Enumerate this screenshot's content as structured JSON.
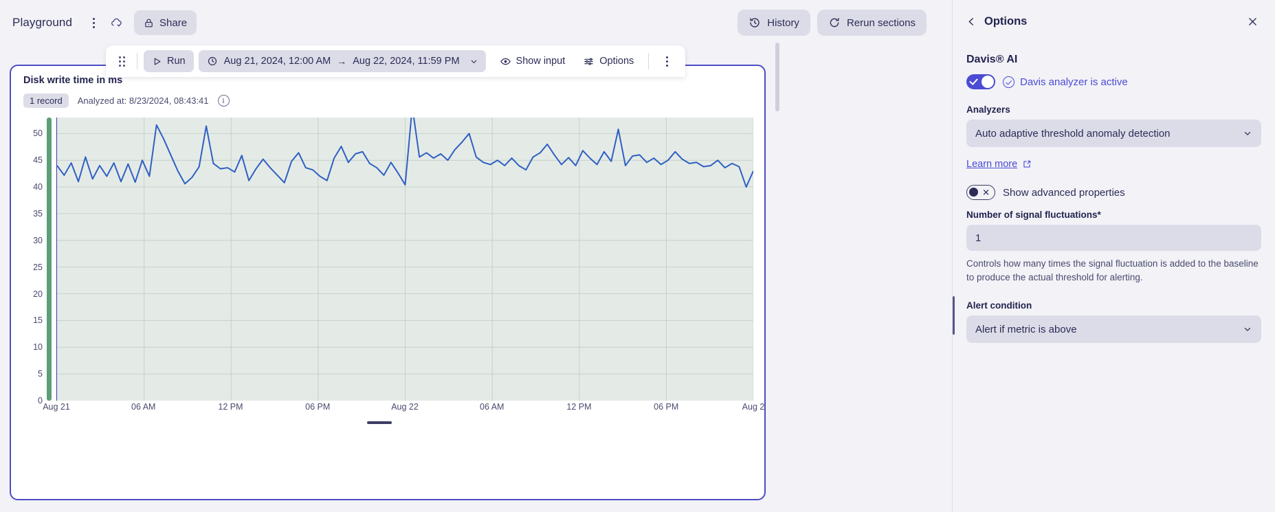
{
  "topbar": {
    "notebook_title": "Playground",
    "more_icon": "kebab-menu-icon",
    "sync_icon": "cloud-sync-icon",
    "share_label": "Share",
    "share_icon": "lock-icon",
    "history_label": "History",
    "history_icon": "history-clock-icon",
    "rerun_label": "Rerun sections",
    "rerun_icon": "refresh-icon"
  },
  "section_toolbar": {
    "drag_handle": "drag-handle-icon",
    "run_label": "Run",
    "run_icon": "play-icon",
    "timeframe_icon": "clock-icon",
    "timeframe_from": "Aug 21, 2024, 12:00 AM",
    "timeframe_arrow": "→",
    "timeframe_to": "Aug 22, 2024, 11:59 PM",
    "timeframe_chevron": "chevron-down-icon",
    "show_input_label": "Show input",
    "show_input_icon": "eye-icon",
    "options_label": "Options",
    "options_icon": "sliders-icon",
    "more_icon": "kebab-menu-icon"
  },
  "section": {
    "title": "Disk write time in ms",
    "record_badge": "1 record",
    "analyzed_at": "Analyzed at: 8/23/2024, 08:43:41",
    "info_icon": "info-icon"
  },
  "chart_data": {
    "type": "line",
    "title": "Disk write time in ms",
    "xlabel": "",
    "ylabel": "",
    "ylim": [
      0,
      53
    ],
    "yticks": [
      0,
      5,
      10,
      15,
      20,
      25,
      30,
      35,
      40,
      45,
      50
    ],
    "xticks": [
      "Aug 21",
      "06 AM",
      "12 PM",
      "06 PM",
      "Aug 22",
      "06 AM",
      "12 PM",
      "06 PM",
      "Aug 2"
    ],
    "grid": true,
    "legend": "none",
    "line_color": "#2f5fc4",
    "plot_background": "#e4ebe6",
    "threshold_band_color": "#5b9e78",
    "series": [
      {
        "name": "Disk write time in ms",
        "values": [
          44.0,
          42.2,
          44.5,
          41.0,
          45.6,
          41.5,
          44.0,
          42.0,
          44.5,
          41.0,
          44.3,
          40.9,
          45.0,
          42.0,
          51.6,
          49.0,
          46.0,
          43.0,
          40.6,
          41.8,
          43.8,
          51.4,
          44.4,
          43.4,
          43.6,
          42.8,
          45.9,
          41.2,
          43.4,
          45.2,
          43.6,
          42.2,
          40.8,
          44.8,
          46.4,
          43.6,
          43.2,
          42.0,
          41.2,
          45.4,
          47.6,
          44.6,
          46.2,
          46.6,
          44.4,
          43.6,
          42.2,
          44.6,
          42.6,
          40.4,
          55.0,
          45.6,
          46.4,
          45.4,
          46.2,
          45.0,
          47.0,
          48.4,
          50.0,
          45.6,
          44.6,
          44.2,
          45.0,
          44.0,
          45.4,
          44.0,
          43.2,
          45.6,
          46.4,
          48.0,
          46.0,
          44.2,
          45.5,
          44.0,
          46.8,
          45.4,
          44.2,
          46.6,
          44.8,
          50.8,
          44.0,
          45.8,
          46.0,
          44.6,
          45.4,
          44.2,
          45.0,
          46.6,
          45.2,
          44.4,
          44.6,
          43.8,
          44.0,
          45.0,
          43.6,
          44.4,
          43.8,
          40.0,
          43.0
        ]
      }
    ]
  },
  "options_panel": {
    "back_icon": "chevron-left-icon",
    "title": "Options",
    "close_icon": "close-icon",
    "davis_section_title": "Davis® AI",
    "davis_toggle_state": "on",
    "davis_status_label": "Davis analyzer is active",
    "davis_status_icon": "check-circle-icon",
    "analyzers_label": "Analyzers",
    "analyzers_value": "Auto adaptive threshold anomaly detection",
    "analyzers_chevron": "chevron-down-icon",
    "learn_more_label": "Learn more",
    "learn_more_icon": "external-link-icon",
    "advanced_toggle_state": "off",
    "advanced_label": "Show advanced properties",
    "fluctuations_label": "Number of signal fluctuations*",
    "fluctuations_value": "1",
    "fluctuations_help": "Controls how many times the signal fluctuation is added to the baseline to produce the actual threshold for alerting.",
    "alert_condition_label": "Alert condition",
    "alert_condition_value": "Alert if metric is above",
    "alert_condition_chevron": "chevron-down-icon"
  },
  "colors": {
    "accent": "#4b4bd4",
    "card_border": "#4c4cc6",
    "chart_line": "#2f5fc4",
    "plot_bg": "#e4ebe6",
    "page_bg": "#f2f2f7"
  }
}
